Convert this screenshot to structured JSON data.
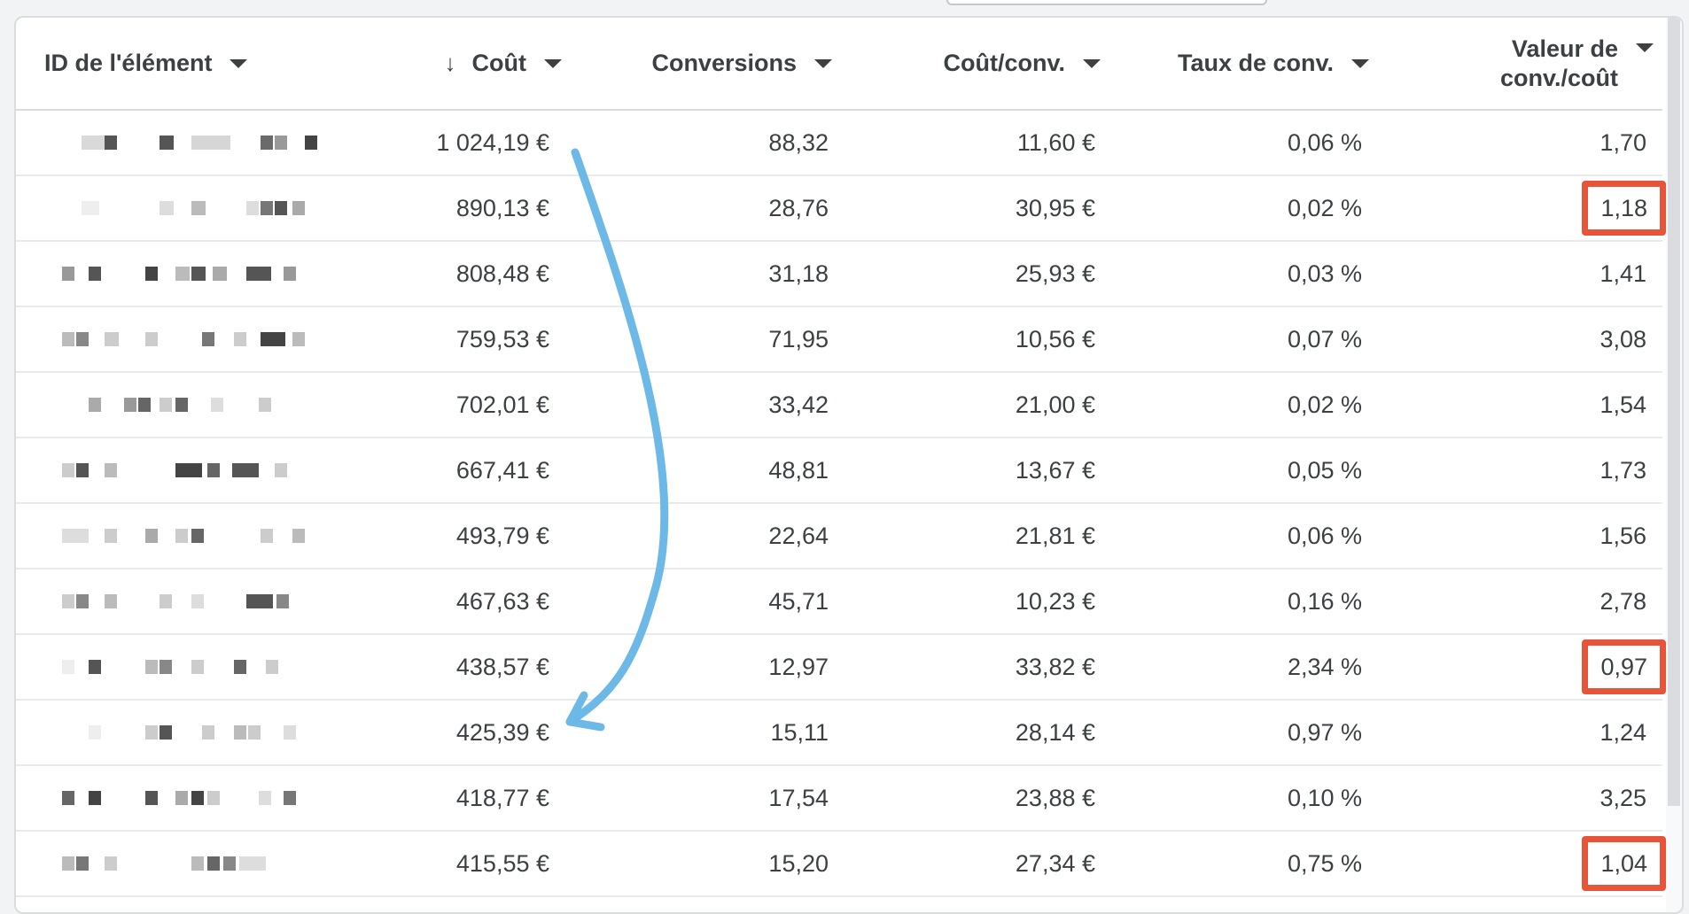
{
  "table": {
    "columns": [
      {
        "label": "ID de l'élément"
      },
      {
        "label": "Coût",
        "sorted": "descending"
      },
      {
        "label": "Conversions"
      },
      {
        "label": "Coût/conv."
      },
      {
        "label": "Taux de conv."
      },
      {
        "label_line1": "Valeur de",
        "label_line2": "conv./coût"
      }
    ],
    "rows": [
      {
        "cost": "1 024,19 €",
        "conversions": "88,32",
        "cost_per_conv": "11,60 €",
        "conv_rate": "0,06 %",
        "value_per_cost": "1,70",
        "highlighted": false
      },
      {
        "cost": "890,13 €",
        "conversions": "28,76",
        "cost_per_conv": "30,95 €",
        "conv_rate": "0,02 %",
        "value_per_cost": "1,18",
        "highlighted": true
      },
      {
        "cost": "808,48 €",
        "conversions": "31,18",
        "cost_per_conv": "25,93 €",
        "conv_rate": "0,03 %",
        "value_per_cost": "1,41",
        "highlighted": false
      },
      {
        "cost": "759,53 €",
        "conversions": "71,95",
        "cost_per_conv": "10,56 €",
        "conv_rate": "0,07 %",
        "value_per_cost": "3,08",
        "highlighted": false
      },
      {
        "cost": "702,01 €",
        "conversions": "33,42",
        "cost_per_conv": "21,00 €",
        "conv_rate": "0,02 %",
        "value_per_cost": "1,54",
        "highlighted": false
      },
      {
        "cost": "667,41 €",
        "conversions": "48,81",
        "cost_per_conv": "13,67 €",
        "conv_rate": "0,05 %",
        "value_per_cost": "1,73",
        "highlighted": false
      },
      {
        "cost": "493,79 €",
        "conversions": "22,64",
        "cost_per_conv": "21,81 €",
        "conv_rate": "0,06 %",
        "value_per_cost": "1,56",
        "highlighted": false
      },
      {
        "cost": "467,63 €",
        "conversions": "45,71",
        "cost_per_conv": "10,23 €",
        "conv_rate": "0,16 %",
        "value_per_cost": "2,78",
        "highlighted": false
      },
      {
        "cost": "438,57 €",
        "conversions": "12,97",
        "cost_per_conv": "33,82 €",
        "conv_rate": "2,34 %",
        "value_per_cost": "0,97",
        "highlighted": true
      },
      {
        "cost": "425,39 €",
        "conversions": "15,11",
        "cost_per_conv": "28,14 €",
        "conv_rate": "0,97 %",
        "value_per_cost": "1,24",
        "highlighted": false
      },
      {
        "cost": "418,77 €",
        "conversions": "17,54",
        "cost_per_conv": "23,88 €",
        "conv_rate": "0,10 %",
        "value_per_cost": "3,25",
        "highlighted": false
      },
      {
        "cost": "415,55 €",
        "conversions": "15,20",
        "cost_per_conv": "27,34 €",
        "conv_rate": "0,75 %",
        "value_per_cost": "1,04",
        "highlighted": true
      }
    ]
  },
  "icons": {
    "sort": "arrow-down-icon",
    "menu": "caret-down-icon",
    "annotation": "curved-arrow-icon"
  },
  "colors": {
    "highlight_border": "#e8543a",
    "annotation_arrow": "#6cb8e6",
    "pixelated_id_dark": "#4a4a4a",
    "pixelated_id_light": "#d4d4d4"
  }
}
